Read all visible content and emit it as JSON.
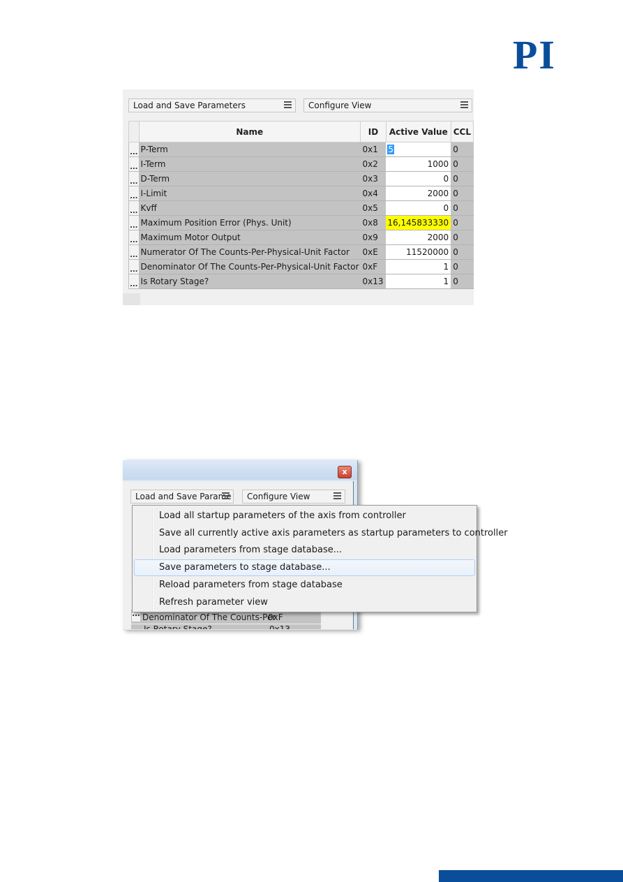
{
  "brand": {
    "logo_text": "PI",
    "color": "#0a4e9b"
  },
  "screenshot1": {
    "combo_load_save": "Load and Save Parameters",
    "combo_configure": "Configure View",
    "columns": [
      "Name",
      "ID",
      "Active Value",
      "CCL"
    ],
    "row_button_label": "...",
    "rows": [
      {
        "name": "P-Term",
        "id": "0x1",
        "value": "5",
        "ccl": "0",
        "state": "selected"
      },
      {
        "name": "I-Term",
        "id": "0x2",
        "value": "1000",
        "ccl": "0",
        "state": "normal"
      },
      {
        "name": "D-Term",
        "id": "0x3",
        "value": "0",
        "ccl": "0",
        "state": "normal"
      },
      {
        "name": "I-Limit",
        "id": "0x4",
        "value": "2000",
        "ccl": "0",
        "state": "normal"
      },
      {
        "name": "Kvff",
        "id": "0x5",
        "value": "0",
        "ccl": "0",
        "state": "normal"
      },
      {
        "name": "Maximum Position Error (Phys. Unit)",
        "id": "0x8",
        "value": "16,145833330",
        "ccl": "0",
        "state": "highlighted"
      },
      {
        "name": "Maximum Motor Output",
        "id": "0x9",
        "value": "2000",
        "ccl": "0",
        "state": "normal"
      },
      {
        "name": "Numerator Of The Counts-Per-Physical-Unit Factor",
        "id": "0xE",
        "value": "11520000",
        "ccl": "0",
        "state": "normal"
      },
      {
        "name": "Denominator Of The Counts-Per-Physical-Unit Factor",
        "id": "0xF",
        "value": "1",
        "ccl": "0",
        "state": "normal"
      },
      {
        "name": "Is Rotary Stage?",
        "id": "0x13",
        "value": "1",
        "ccl": "0",
        "state": "normal"
      }
    ],
    "highlight_color": "#ffff00"
  },
  "screenshot2": {
    "close_label": "x",
    "combo_load_save": "Load and Save Parame",
    "combo_configure": "Configure View",
    "menu_items": [
      "Load all startup parameters of the axis from controller",
      "Save all currently active axis parameters as startup parameters to controller",
      "Load parameters from stage database...",
      "Save parameters to stage database...",
      "Reload parameters from stage database",
      "Refresh parameter view"
    ],
    "hovered_item_index": 3,
    "background_rows": [
      {
        "name": "Denominator Of The Counts-Per",
        "id": "0xF"
      },
      {
        "name": "Is Rotary Stage?",
        "id": "0x13"
      }
    ]
  }
}
